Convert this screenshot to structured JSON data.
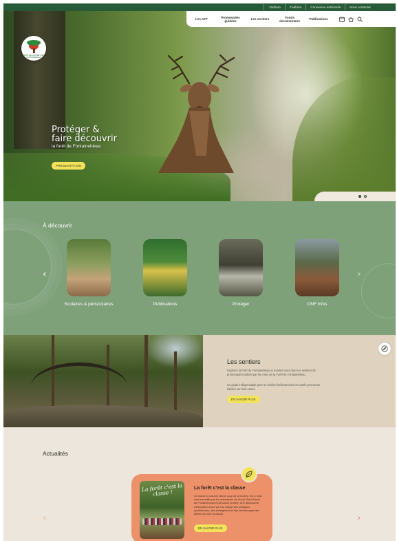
{
  "topbar": {
    "links": [
      "J'adhère",
      "J'adhère",
      "Connexion adhérents",
      "Nous contacter"
    ]
  },
  "logo": {
    "text": "AMIS DE LA FORÊT DE FONTAINEBLEAU"
  },
  "nav": {
    "items": [
      "Les AFF",
      "Promenades guidées",
      "Les sentiers",
      "Fonds documentaire",
      "Publications"
    ],
    "icons": [
      "calendar-icon",
      "bag-icon",
      "search-icon"
    ]
  },
  "hero": {
    "title_line1": "Protéger &",
    "title_line2": "faire découvrir",
    "subtitle": "la forêt de Fontainebleau",
    "button": "PRÉSENTATION",
    "slides": 2,
    "active_slide": 1
  },
  "discover": {
    "title": "À découvrir",
    "cards": [
      {
        "label": "Scolaires & périscolaires"
      },
      {
        "label": "Publications"
      },
      {
        "label": "Protéger"
      },
      {
        "label": "ONF infos"
      }
    ]
  },
  "trails": {
    "title": "Les sentiers",
    "paragraph1": "Explorez la forêt de Fontainebleau et évadez-vous dans les sentiers de promenades balisés par les Amis de la Forêt de Fontainebleau.",
    "paragraph2": "Un guide indispensable pour se révéler facilement les les unités procurées balisés sur trois cases.",
    "button": "EN SAVOIR PLUS"
  },
  "news": {
    "title": "Actualités",
    "card": {
      "image_text": "La forêt c'est la classe !",
      "title": "La forêt c'est la classe",
      "body": "Ce mardi 24 octobre dès le coup de la rentrée, les 3 CM2 sont accueillis par les animateurs de l'école Saint-Denis de Fontainebleau et découvrir la forêt. Une découverte d'éducation d'une vie à la charge des pratiques quotidiennes, des enseignants et des personnages des élèves de vivre la nature.",
      "button": "EN SAVOIR PLUS"
    }
  },
  "colors": {
    "topbar": "#275a36",
    "discover_bg": "#7ea17a",
    "trails_bg": "#dfd3c0",
    "news_bg": "#ece6dd",
    "news_card": "#ec916a",
    "button_yellow": "#f4e35a"
  }
}
